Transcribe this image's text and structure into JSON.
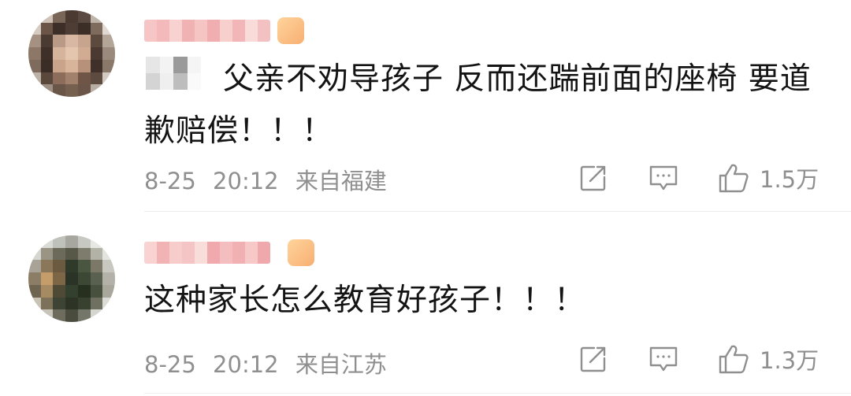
{
  "comments": [
    {
      "text": "父亲不劝导孩子 反而还踹前面的座椅 要道歉赔偿！！！",
      "date": "8-25",
      "time": "20:12",
      "location": "来自福建",
      "like_count": "1.5万",
      "icons": {
        "share": "share-icon",
        "reply": "comment-icon",
        "like": "thumbs-up-icon"
      }
    },
    {
      "text": "这种家长怎么教育好孩子！！！",
      "date": "8-25",
      "time": "20:12",
      "location": "来自江苏",
      "like_count": "1.3万",
      "icons": {
        "share": "share-icon",
        "reply": "comment-icon",
        "like": "thumbs-up-icon"
      }
    }
  ],
  "colors": {
    "text_primary": "#141414",
    "text_secondary": "#8f8f8f",
    "badge": "#f6a15a",
    "divider": "#ececec"
  }
}
